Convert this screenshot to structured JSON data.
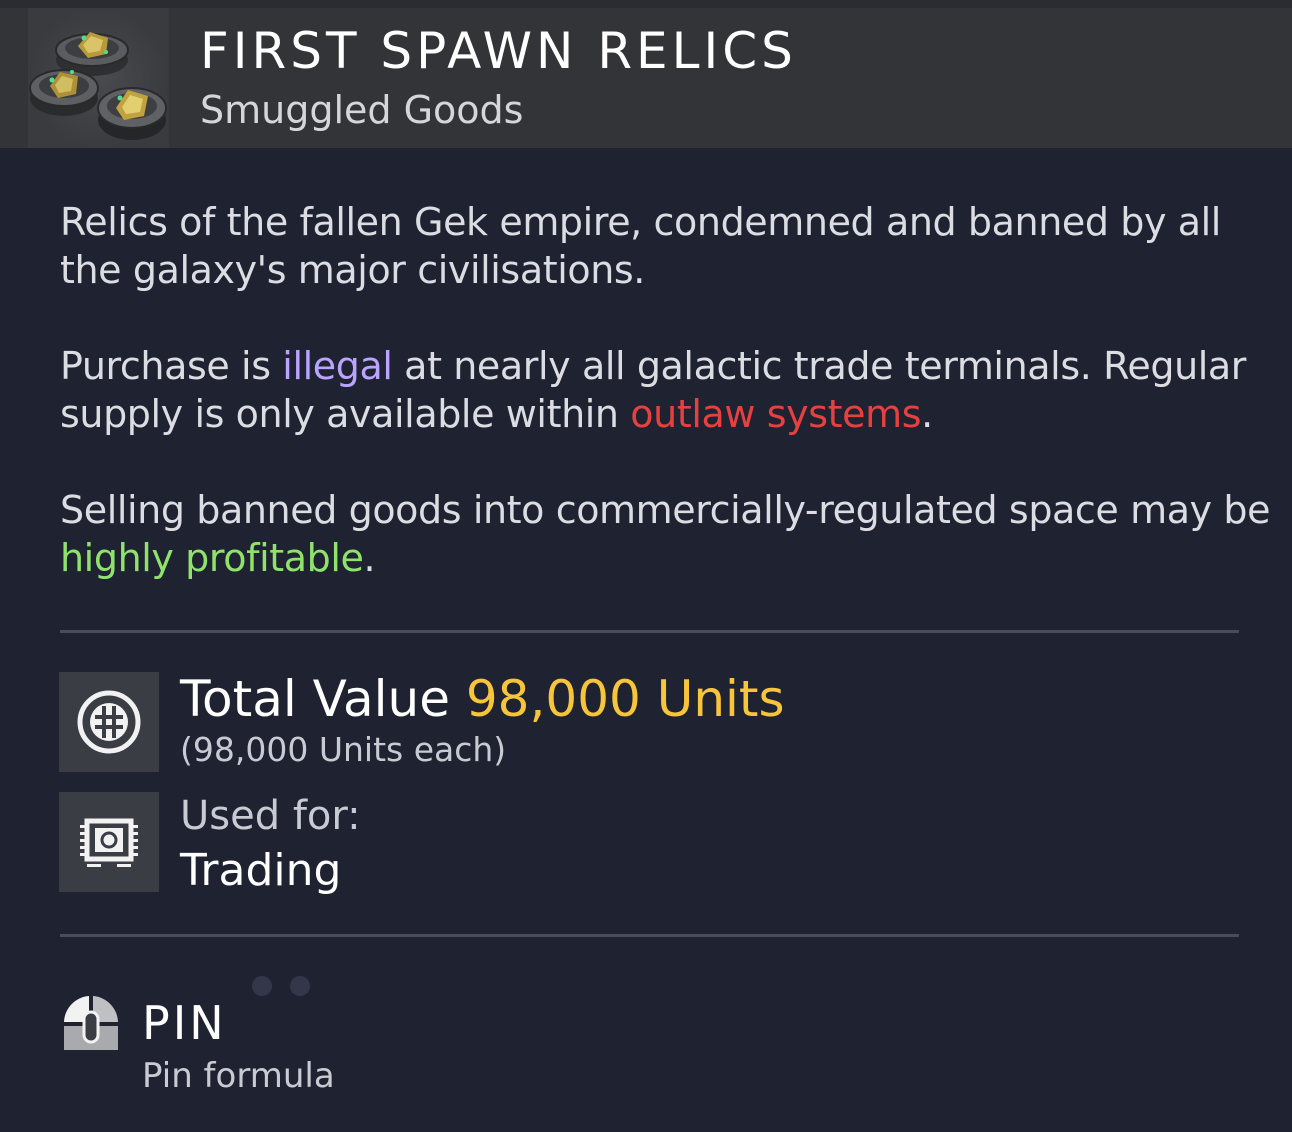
{
  "item": {
    "title": "FIRST SPAWN RELICS",
    "subtitle": "Smuggled Goods",
    "icon": "relic-stones-icon"
  },
  "description": {
    "p1_line1": "Relics of the fallen Gek empire, condemned and banned by all",
    "p1_line2": "the galaxy's major civilisations.",
    "p2_line1_a": "Purchase is ",
    "p2_line1_hl": "illegal",
    "p2_line1_b": " at nearly all galactic trade terminals. Regular",
    "p2_line2_a": "supply is only available within ",
    "p2_line2_hl": "outlaw systems",
    "p2_line2_b": ".",
    "p3_line1": "Selling banned goods into commercially-regulated space may be",
    "p3_line2_hl": "highly profitable",
    "p3_line2_b": "."
  },
  "value": {
    "label": "Total Value ",
    "amount": "98,000 Units",
    "each": "(98,000 Units each)",
    "icon": "units-currency-icon"
  },
  "usage": {
    "label": "Used for:",
    "value": "Trading",
    "icon": "trade-chip-icon"
  },
  "pin": {
    "label": "PIN",
    "sub": "Pin formula",
    "icon": "mouse-click-icon"
  },
  "colors": {
    "illegal": "#b9a4ff",
    "outlaw": "#e6413e",
    "profitable": "#8fe36a",
    "units": "#f7c53a"
  }
}
